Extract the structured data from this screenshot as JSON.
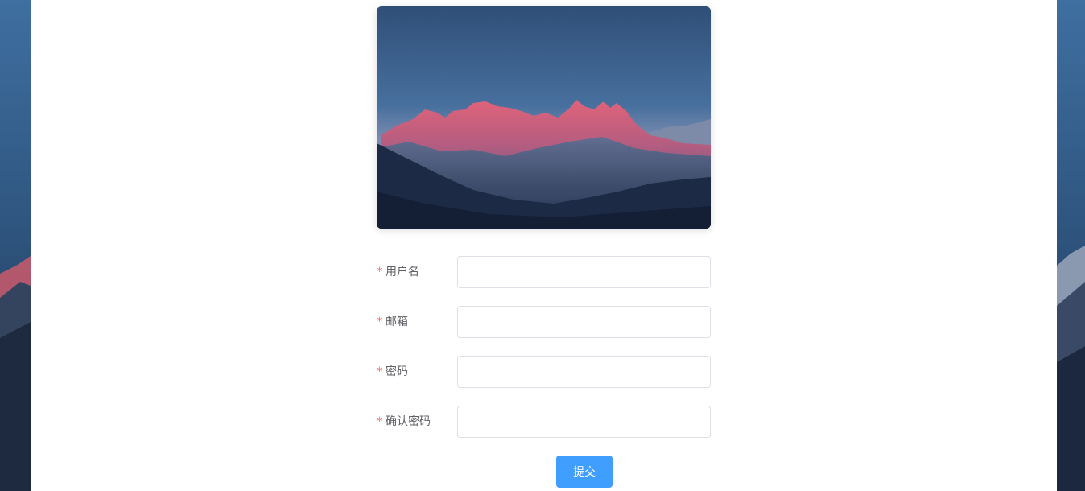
{
  "hero": {
    "image_desc": "mountain-sunset"
  },
  "form": {
    "fields": [
      {
        "label": "用户名",
        "required_mark": "*",
        "value": "",
        "placeholder": ""
      },
      {
        "label": "邮箱",
        "required_mark": "*",
        "value": "",
        "placeholder": ""
      },
      {
        "label": "密码",
        "required_mark": "*",
        "value": "",
        "placeholder": ""
      },
      {
        "label": "确认密码",
        "required_mark": "*",
        "value": "",
        "placeholder": ""
      }
    ],
    "submit_label": "提交"
  },
  "colors": {
    "primary": "#409eff",
    "required": "#f56c6c",
    "label": "#606266",
    "border": "#dcdfe6"
  }
}
